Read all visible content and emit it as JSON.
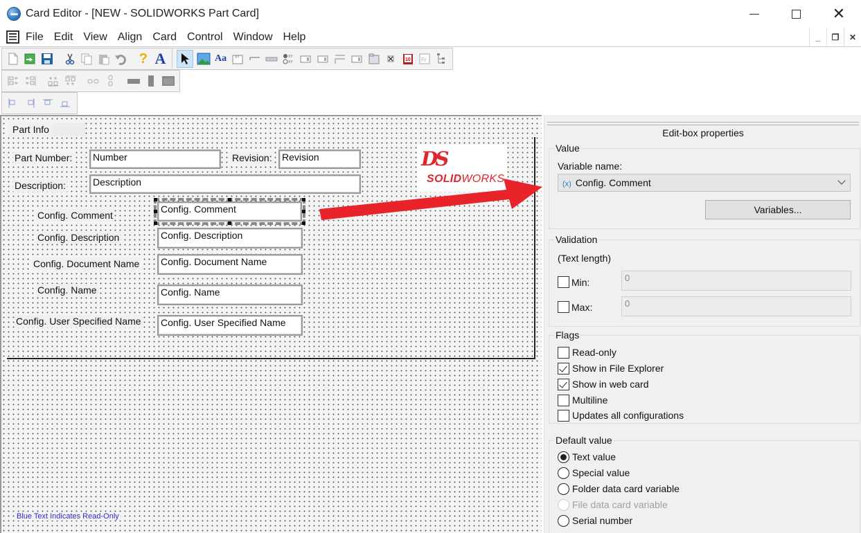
{
  "window": {
    "title": "Card Editor - [NEW - SOLIDWORKS Part Card]",
    "controls": {
      "minimize": "—",
      "maximize": "☐",
      "close": "✕"
    },
    "mdi_controls": {
      "minimize": "‗",
      "restore": "❐",
      "close": "✕"
    }
  },
  "menu": {
    "items": [
      "File",
      "Edit",
      "View",
      "Align",
      "Card",
      "Control",
      "Window",
      "Help"
    ]
  },
  "toolbars": {
    "main": [
      "new-icon",
      "open-icon",
      "save-icon",
      "cut-icon",
      "copy-icon",
      "paste-icon",
      "undo-icon",
      "help-icon",
      "font-icon",
      "select-pointer-icon",
      "picture-icon",
      "label-icon",
      "frame-icon",
      "line-icon",
      "edit-box-icon",
      "radio-button-icon",
      "combo-box-icon",
      "list-box-icon",
      "group-box-icon",
      "drop-list-icon",
      "tab-icon",
      "checkbox-icon",
      "preview-icon",
      "frame-properties-icon",
      "tree-icon"
    ],
    "align": [
      "align-left-icon",
      "align-right-icon",
      "align-top-icon",
      "align-bottom-icon",
      "space-horizontal-icon",
      "space-vertical-icon",
      "same-width-icon",
      "same-height-icon",
      "same-size-icon"
    ],
    "anchor": [
      "anchor-left-icon",
      "anchor-right-icon",
      "anchor-top-icon",
      "anchor-bottom-icon"
    ]
  },
  "card": {
    "tab_label": "Part Info",
    "fields": [
      {
        "label": "Part Number:",
        "value": "Number"
      },
      {
        "label": "Revision:",
        "value": "Revision"
      },
      {
        "label": "Description:",
        "value": "Description"
      },
      {
        "label": "Config. Comment",
        "value": "Config. Comment"
      },
      {
        "label": "Config. Description",
        "value": "Config. Description"
      },
      {
        "label": "Config. Document Name",
        "value": "Config. Document Name"
      },
      {
        "label": "Config. Name",
        "value": "Config. Name"
      },
      {
        "label": "Config. User Specified Name",
        "value": "Config. User Specified Name"
      }
    ],
    "logo": {
      "mark": "DS",
      "brand_bold": "SOLID",
      "brand_light": "WORKS"
    },
    "footnote": "Blue Text Indicates Read-Only"
  },
  "colors": {
    "logo_red": "#e0252f",
    "annotation_arrow": "#e8232a",
    "footnote_blue": "#2a2acc",
    "selection_blue": "#cce4f7"
  },
  "properties": {
    "title": "Edit-box properties",
    "value_group": {
      "title": "Value",
      "variable_label": "Variable name:",
      "variable_prefix": "(x)",
      "variable_selected": "Config. Comment",
      "variables_button": "Variables..."
    },
    "validation_group": {
      "title": "Validation",
      "subtitle": "(Text length)",
      "min": {
        "label": "Min:",
        "checked": false,
        "value": "0"
      },
      "max": {
        "label": "Max:",
        "checked": false,
        "value": "0"
      }
    },
    "flags_group": {
      "title": "Flags",
      "items": [
        {
          "label": "Read-only",
          "checked": false
        },
        {
          "label": "Show in File Explorer",
          "checked": true
        },
        {
          "label": "Show in web card",
          "checked": true
        },
        {
          "label": "Multiline",
          "checked": false
        },
        {
          "label": "Updates all configurations",
          "checked": false
        }
      ]
    },
    "default_group": {
      "title": "Default value",
      "options": [
        {
          "label": "Text value",
          "selected": true,
          "enabled": true
        },
        {
          "label": "Special value",
          "selected": false,
          "enabled": true
        },
        {
          "label": "Folder data card variable",
          "selected": false,
          "enabled": true
        },
        {
          "label": "File data card variable",
          "selected": false,
          "enabled": false
        },
        {
          "label": "Serial number",
          "selected": false,
          "enabled": true
        }
      ]
    }
  }
}
